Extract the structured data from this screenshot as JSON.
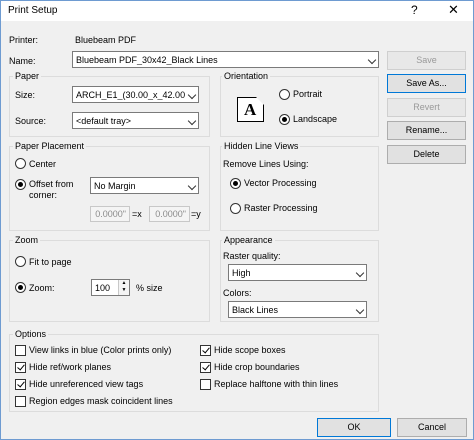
{
  "window": {
    "title": "Print Setup",
    "help_glyph": "?",
    "close_glyph": "✕"
  },
  "printer": {
    "label": "Printer:",
    "value": "Bluebeam PDF"
  },
  "name": {
    "label": "Name:",
    "value": "Bluebeam PDF_30x42_Black Lines"
  },
  "buttons": {
    "save": "Save",
    "save_as": "Save As...",
    "revert": "Revert",
    "rename": "Rename...",
    "delete": "Delete",
    "ok": "OK",
    "cancel": "Cancel"
  },
  "paper": {
    "title": "Paper",
    "size_label": "Size:",
    "size_value": "ARCH_E1_(30.00_x_42.00",
    "source_label": "Source:",
    "source_value": "<default tray>"
  },
  "orientation": {
    "title": "Orientation",
    "portrait": "Portrait",
    "landscape": "Landscape",
    "selected": "Landscape",
    "icon_letter": "A"
  },
  "paper_placement": {
    "title": "Paper Placement",
    "center": "Center",
    "offset_line1": "Offset from",
    "offset_line2": "corner:",
    "selected": "Offset from corner",
    "offset_value": "No Margin",
    "x_value": "0.0000\"",
    "x_suffix": "=x",
    "y_value": "0.0000\"",
    "y_suffix": "=y"
  },
  "hidden_line_views": {
    "title": "Hidden Line Views",
    "remove_label": "Remove Lines Using:",
    "vector": "Vector Processing",
    "raster": "Raster Processing",
    "selected": "Vector Processing"
  },
  "zoom": {
    "title": "Zoom",
    "fit": "Fit to page",
    "zoom_label": "Zoom:",
    "selected": "Zoom",
    "value": "100",
    "suffix": "% size"
  },
  "appearance": {
    "title": "Appearance",
    "raster_label": "Raster quality:",
    "raster_value": "High",
    "colors_label": "Colors:",
    "colors_value": "Black Lines"
  },
  "options": {
    "title": "Options",
    "items": [
      {
        "label": "View links in blue (Color prints only)",
        "checked": false
      },
      {
        "label": "Hide ref/work planes",
        "checked": true
      },
      {
        "label": "Hide unreferenced view tags",
        "checked": true
      },
      {
        "label": "Region edges mask coincident lines",
        "checked": false
      },
      {
        "label": "Hide scope boxes",
        "checked": true
      },
      {
        "label": "Hide crop boundaries",
        "checked": true
      },
      {
        "label": "Replace halftone with thin lines",
        "checked": false
      }
    ]
  }
}
